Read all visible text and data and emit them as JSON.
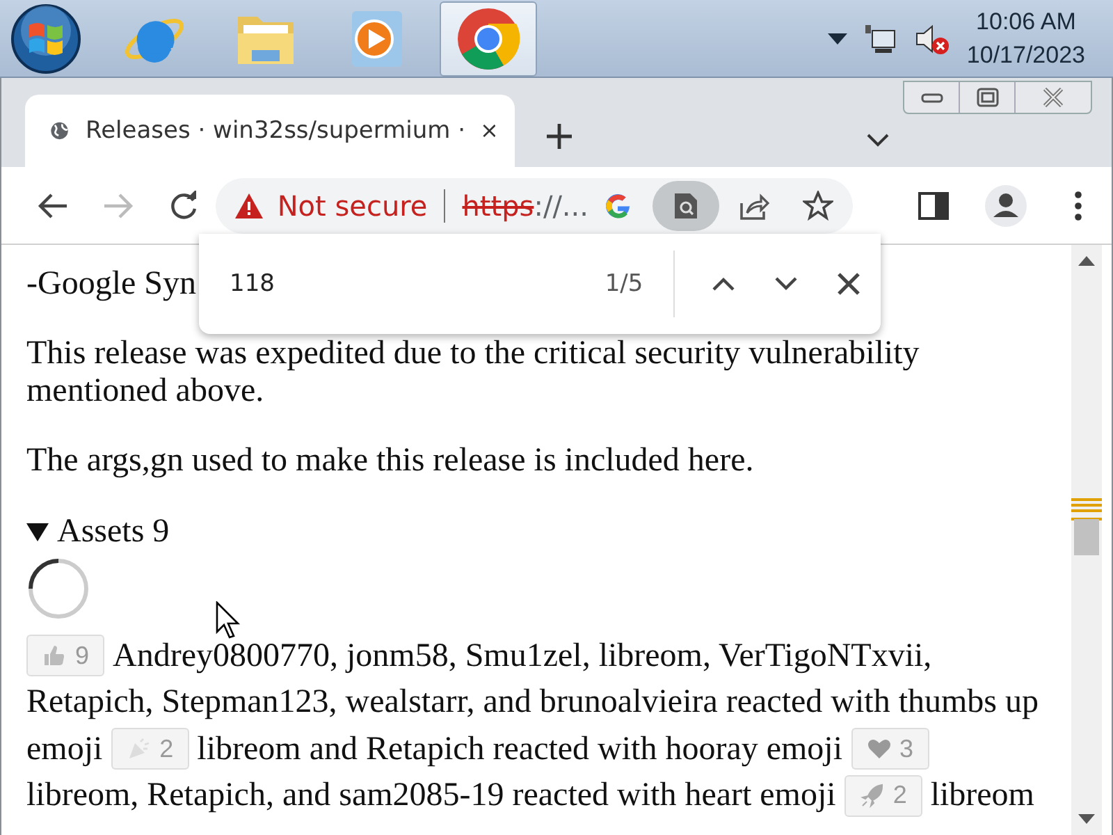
{
  "taskbar": {
    "apps": [
      {
        "kind": "ie",
        "selected": false
      },
      {
        "kind": "folder",
        "selected": false
      },
      {
        "kind": "player",
        "selected": false
      },
      {
        "kind": "chrome",
        "selected": true
      }
    ],
    "time": "10:06 AM",
    "date": "10/17/2023"
  },
  "tab": {
    "title": "Releases · win32ss/supermium ·",
    "selected": true
  },
  "toolbar": {
    "back_disabled": false,
    "forward_disabled": true
  },
  "omnibox": {
    "warning": "Not secure",
    "scheme": "https",
    "rest": "://...",
    "lens_active": true
  },
  "find_bar": {
    "query": "118",
    "count": "1/5"
  },
  "content": [
    {
      "kind": "text",
      "text": "-Google Syn"
    },
    {
      "kind": "text",
      "text": "This release was expedited due to the critical security vulnerability mentioned above."
    },
    {
      "kind": "text",
      "text": "The args,gn used to make this release is included here."
    },
    {
      "kind": "details",
      "label": "Assets 9",
      "expanded": true
    },
    {
      "kind": "spinner"
    },
    {
      "kind": "reactions",
      "items": [
        {
          "kind": "thumbs",
          "count": "9"
        },
        {
          "kind": "text",
          "text": "Andrey0800770, jonm58, Smu1zel, libreom, VerTigoNTxvii,"
        },
        {
          "kind": "text",
          "text": "Retapich, Stepman123, wealstarr, and brunoalvieira reacted with thumbs up"
        },
        {
          "kind": "text",
          "text": "emoji"
        },
        {
          "kind": "hooray",
          "count": "2"
        },
        {
          "kind": "text",
          "text": "libreom and Retapich reacted with hooray emoji"
        },
        {
          "kind": "heart",
          "count": "3"
        },
        {
          "kind": "text",
          "text": "libreom, Retapich, and sam2085-19 reacted with heart emoji"
        },
        {
          "kind": "rocket",
          "count": "2"
        },
        {
          "kind": "text",
          "text": "libreom"
        }
      ]
    }
  ]
}
